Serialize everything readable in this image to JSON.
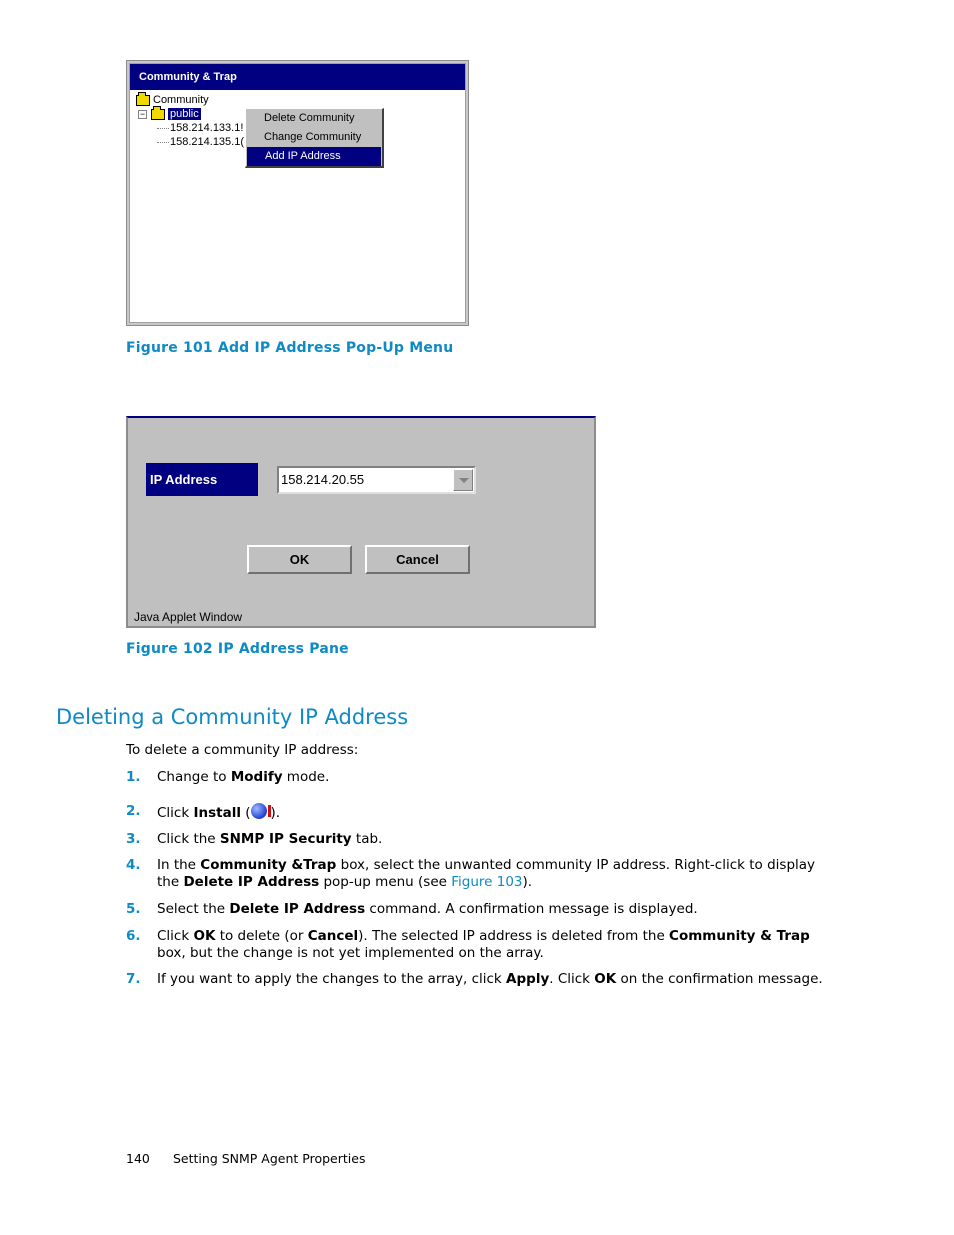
{
  "figure101": {
    "window_title": "Community & Trap",
    "tree": {
      "root": "Community",
      "child": "public",
      "leaves": [
        "158.214.133.1!",
        "158.214.135.1("
      ]
    },
    "context_menu": {
      "items": [
        {
          "label": "Delete Community",
          "active": false
        },
        {
          "label": "Change Community",
          "active": false
        },
        {
          "label": "Add IP Address",
          "active": true
        }
      ]
    },
    "caption": "Figure 101  Add IP Address Pop-Up Menu"
  },
  "figure102": {
    "field_label": "IP Address",
    "field_value": "158.214.20.55",
    "ok_label": "OK",
    "cancel_label": "Cancel",
    "status_text": "Java Applet Window",
    "caption": "Figure 102  IP Address Pane"
  },
  "section": {
    "heading": "Deleting a Community IP Address",
    "intro": "To delete a community IP address:",
    "steps": [
      {
        "num": "1.",
        "parts": [
          "Change to ",
          "Modify",
          " mode."
        ]
      },
      {
        "num": "2.",
        "parts": [
          "Click ",
          "Install",
          " (",
          ")."
        ]
      },
      {
        "num": "3.",
        "parts": [
          "Click the ",
          "SNMP IP Security",
          " tab."
        ]
      },
      {
        "num": "4.",
        "parts": [
          "In the ",
          "Community &Trap",
          " box, select the unwanted community IP address. Right-click to display the ",
          "Delete IP Address",
          " pop-up menu (see ",
          "Figure 103",
          ")."
        ]
      },
      {
        "num": "5.",
        "parts": [
          "Select the ",
          "Delete IP Address",
          " command. A confirmation message is displayed."
        ]
      },
      {
        "num": "6.",
        "parts": [
          "Click ",
          "OK",
          " to delete (or ",
          "Cancel",
          "). The selected IP address is deleted from the ",
          "Community & Trap",
          " box, but the change is not yet implemented on the array."
        ]
      },
      {
        "num": "7.",
        "parts": [
          "If you want to apply the changes to the array, click ",
          "Apply",
          ". Click ",
          "OK",
          " on the confirmation message."
        ]
      }
    ]
  },
  "footer": {
    "page_number": "140",
    "chapter": "Setting SNMP Agent Properties"
  },
  "colors": {
    "accent": "#0e8ac4",
    "titlebar": "#000080",
    "dialog_bg": "#c0c0c0"
  }
}
